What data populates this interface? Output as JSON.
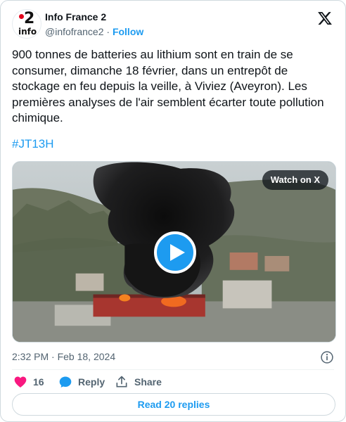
{
  "author": {
    "display_name": "Info France 2",
    "handle": "@infofrance2",
    "separator": "·",
    "follow_label": "Follow",
    "avatar": {
      "digit": "2",
      "word": "info",
      "brand_dot_color": "#e2001a"
    }
  },
  "tweet": {
    "text": "900 tonnes de batteries au lithium sont en train de se consumer, dimanche 18 février, dans un entrepôt de stockage en feu depuis la veille, à Viviez (Aveyron). Les premières analyses de l'air semblent écarter toute pollution chimique.",
    "hashtag": "#JT13H"
  },
  "media": {
    "type": "video",
    "watch_label": "Watch on X",
    "play_icon": "play-icon"
  },
  "meta": {
    "time": "2:32 PM",
    "separator": "·",
    "date": "Feb 18, 2024",
    "info_icon": "info-icon"
  },
  "actions": {
    "like_count": "16",
    "reply_label": "Reply",
    "share_label": "Share",
    "read_replies_label": "Read 20 replies"
  },
  "colors": {
    "accent": "#1d9bf0",
    "like": "#f91880",
    "text": "#0f1419",
    "secondary": "#536471",
    "border": "#cfd9de"
  }
}
